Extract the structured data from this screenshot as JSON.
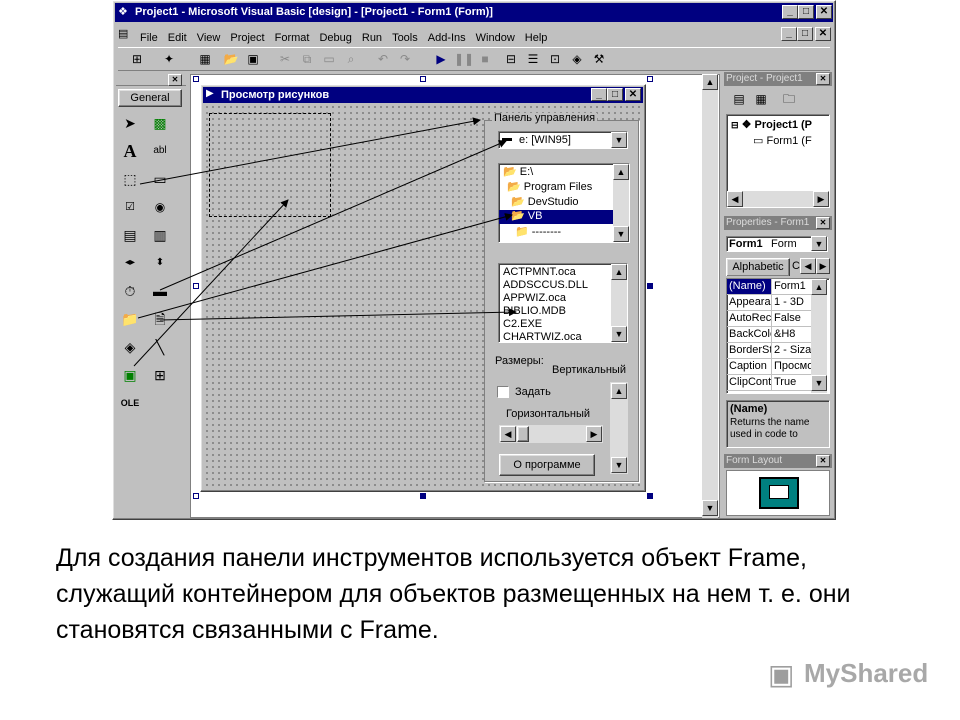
{
  "window": {
    "title": "Project1 - Microsoft Visual Basic [design] - [Project1 - Form1 (Form)]",
    "controls": [
      "_",
      "□",
      "✕"
    ],
    "inner_controls": [
      "_",
      "□",
      "✕"
    ]
  },
  "menu": [
    "File",
    "Edit",
    "View",
    "Project",
    "Format",
    "Debug",
    "Run",
    "Tools",
    "Add-Ins",
    "Window",
    "Help"
  ],
  "toolbox": {
    "tab": "General"
  },
  "form": {
    "title": "Просмотр рисунков",
    "frame_caption": "Панель управления",
    "drive": "e: [WIN95]",
    "dirs": [
      "E:\\",
      "Program Files",
      "DevStudio",
      "VB",
      "--------"
    ],
    "files": [
      "ACTPMNT.oca",
      "ADDSCCUS.DLL",
      "APPWIZ.oca",
      "BIBLIO.MDB",
      "C2.EXE",
      "CHARTWIZ.oca"
    ],
    "sizes_label": "Размеры:",
    "vertical_label": "Вертикальный",
    "checkbox_label": "Задать",
    "horizontal_label": "Горизонтальный",
    "about_button": "О программе"
  },
  "project": {
    "title": "Project - Project1",
    "root": "Project1 (P",
    "child": "Form1 (F"
  },
  "properties": {
    "title": "Properties - Form1",
    "object": "Form1",
    "object_type": "Form",
    "tab": "Alphabetic",
    "tab2": "C",
    "rows": [
      {
        "name": "(Name)",
        "value": "Form1"
      },
      {
        "name": "Appeara",
        "value": "1 - 3D"
      },
      {
        "name": "AutoRec",
        "value": "False"
      },
      {
        "name": "BackColc",
        "value": "&H8"
      },
      {
        "name": "BorderSt",
        "value": "2 - Siza"
      },
      {
        "name": "Caption",
        "value": "Просмо"
      },
      {
        "name": "ClipCont",
        "value": "True"
      }
    ],
    "desc_title": "(Name)",
    "desc_text": "Returns the name used in code to"
  },
  "form_layout": {
    "title": "Form Layout"
  },
  "caption": "Для создания панели инструментов используется объект Frame, служащий контейнером для объектов размещенных на нем т. е. они становятся связанными с Frame.",
  "watermark": "MyShared"
}
